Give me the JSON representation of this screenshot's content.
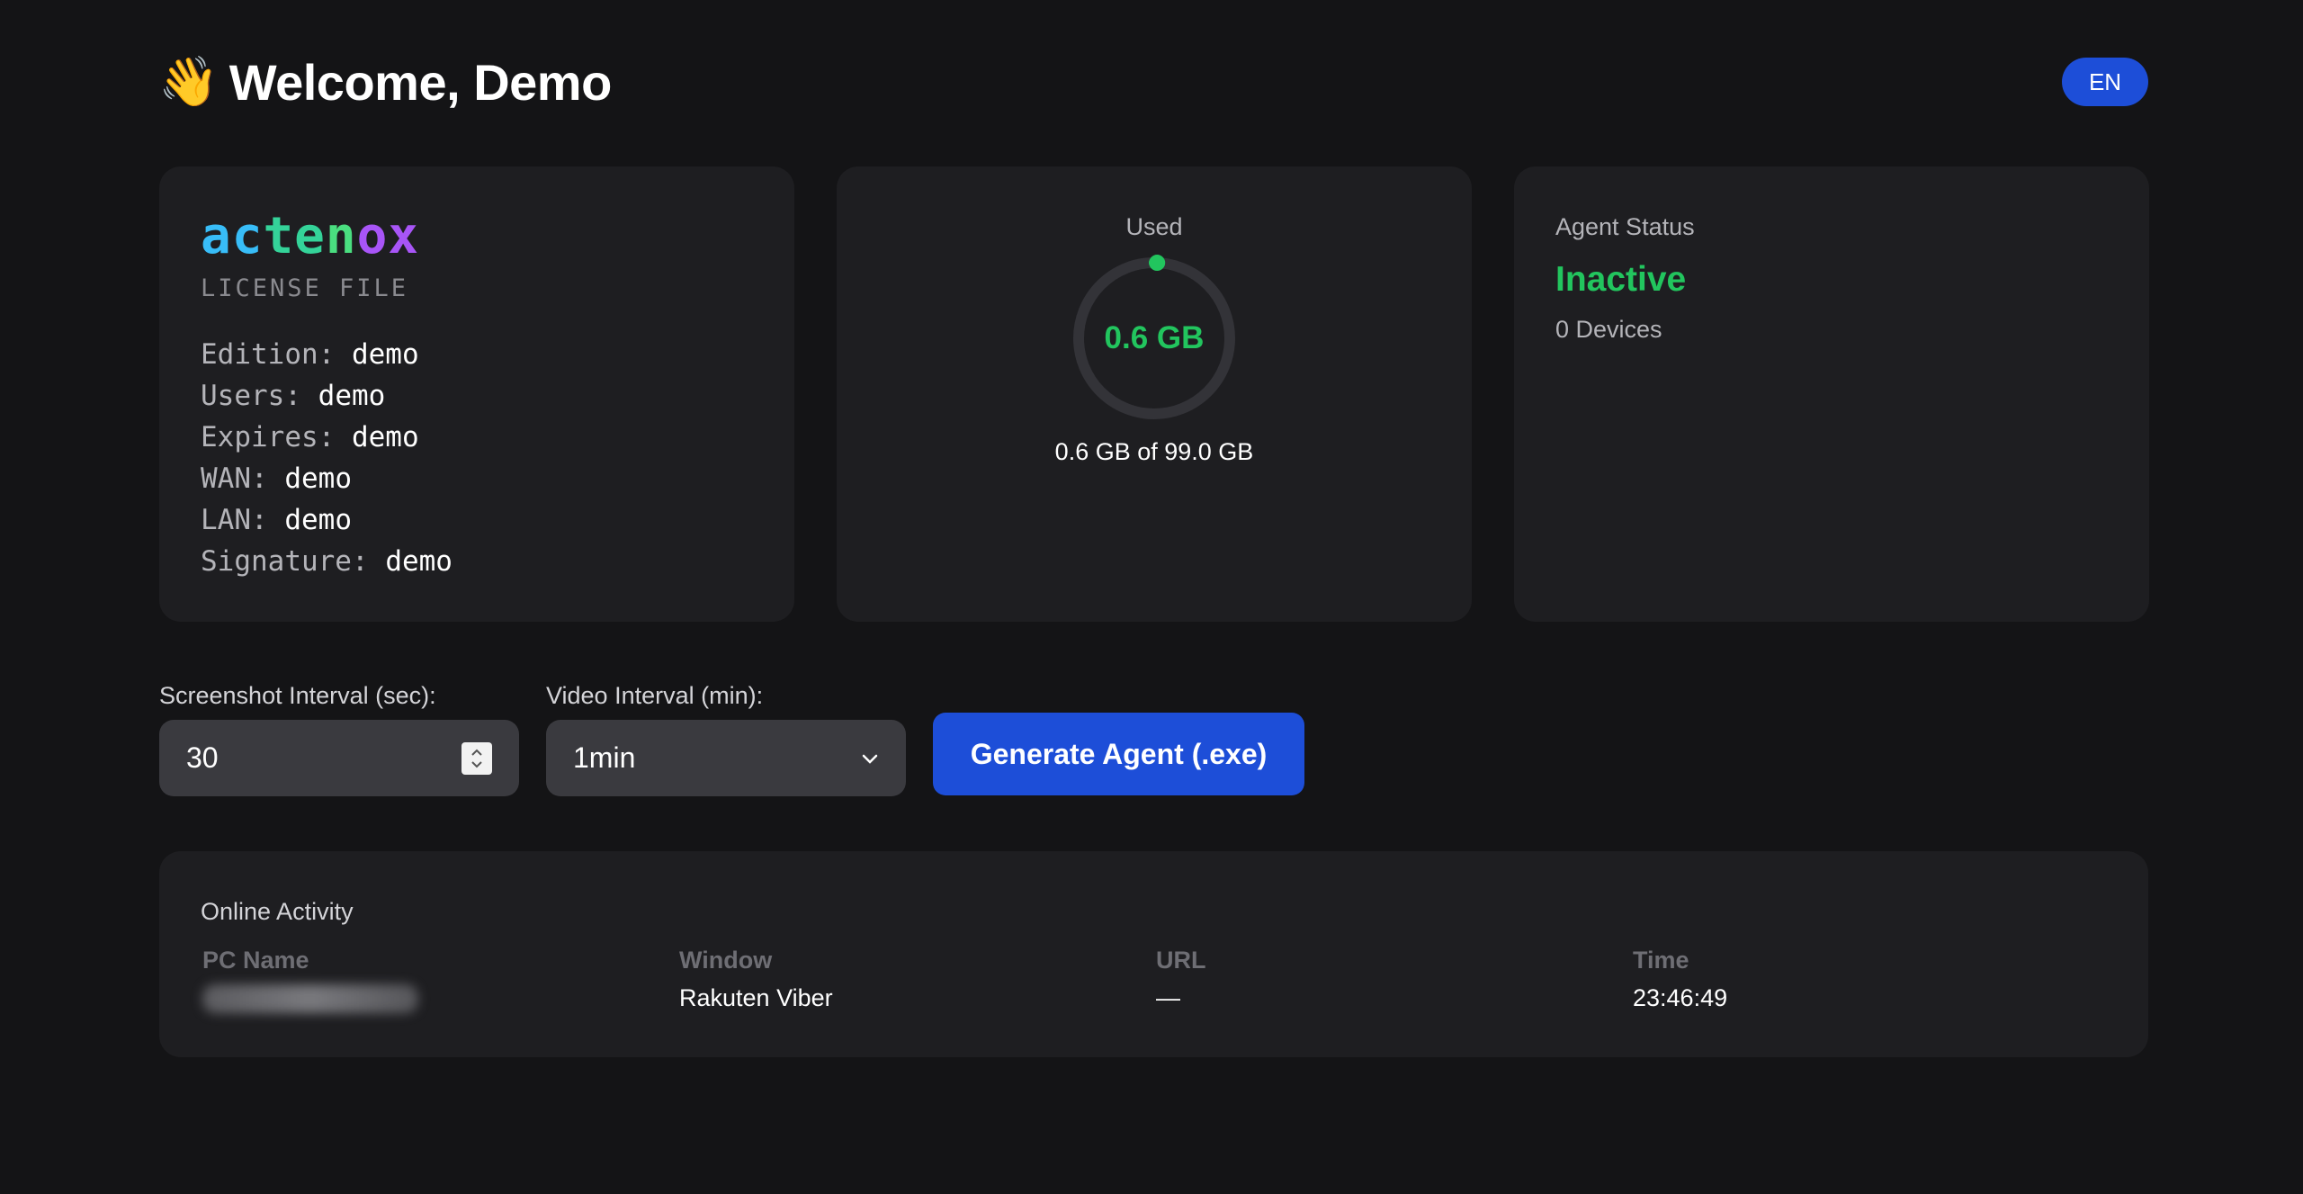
{
  "header": {
    "greeting": "Welcome, Demo",
    "wave_icon": "👋",
    "language": "EN"
  },
  "license": {
    "brand": [
      "ac",
      "te",
      "n",
      "ox"
    ],
    "subtitle": "LICENSE FILE",
    "fields": [
      {
        "key": "Edition:",
        "value": "demo"
      },
      {
        "key": "Users:",
        "value": "demo"
      },
      {
        "key": "Expires:",
        "value": "demo"
      },
      {
        "key": "WAN:",
        "value": "demo"
      },
      {
        "key": "LAN:",
        "value": "demo"
      },
      {
        "key": "Signature:",
        "value": "demo"
      }
    ],
    "brand_colors": [
      "#38bdf8",
      "#34d399",
      "#4ade80",
      "#a855f7"
    ]
  },
  "usage": {
    "label": "Used",
    "value": "0.6 GB",
    "detail": "0.6 GB of 99.0 GB",
    "used_gb": 0.6,
    "total_gb": 99.0,
    "accent": "#22c55e",
    "track": "#333338"
  },
  "agent": {
    "label": "Agent Status",
    "status": "Inactive",
    "devices": "0 Devices",
    "status_color": "#22c55e"
  },
  "controls": {
    "screenshot_label": "Screenshot Interval (sec):",
    "screenshot_value": "30",
    "video_label": "Video Interval (min):",
    "video_value": "1min",
    "generate_label": "Generate Agent (.exe)",
    "accent": "#1d4ed8"
  },
  "activity": {
    "title": "Online Activity",
    "columns": [
      "PC Name",
      "Window",
      "URL",
      "Time"
    ],
    "rows": [
      {
        "pc_name": "",
        "window": "Rakuten Viber",
        "url": "—",
        "time": "23:46:49"
      }
    ]
  }
}
